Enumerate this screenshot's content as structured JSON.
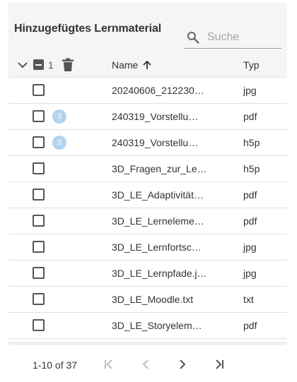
{
  "header": {
    "title": "Hinzugefügtes Lernmaterial",
    "search_placeholder": "Suche"
  },
  "table": {
    "selected_count": "1",
    "columns": {
      "name": "Name",
      "type": "Typ"
    },
    "sort": {
      "column": "Name",
      "direction": "ascending"
    },
    "rows": [
      {
        "name": "20240606_212230…",
        "type": "jpg",
        "badge": ""
      },
      {
        "name": "240319_Vorstellu…",
        "type": "pdf",
        "badge": "3"
      },
      {
        "name": "240319_Vorstellu…",
        "type": "h5p",
        "badge": "3"
      },
      {
        "name": "3D_Fragen_zur_Le…",
        "type": "h5p",
        "badge": ""
      },
      {
        "name": "3D_LE_Adaptivität…",
        "type": "pdf",
        "badge": ""
      },
      {
        "name": "3D_LE_Lerneleme…",
        "type": "pdf",
        "badge": ""
      },
      {
        "name": "3D_LE_Lernfortsc…",
        "type": "jpg",
        "badge": ""
      },
      {
        "name": "3D_LE_Lernpfade.j…",
        "type": "jpg",
        "badge": ""
      },
      {
        "name": "3D_LE_Moodle.txt",
        "type": "txt",
        "badge": ""
      },
      {
        "name": "3D_LE_Storyelem…",
        "type": "pdf",
        "badge": ""
      }
    ]
  },
  "pagination": {
    "range_label": "1-10 of 37"
  },
  "colors": {
    "header_bg": "#f5f5f5",
    "badge_bg": "#b3d4ef",
    "icon": "#555555",
    "disabled_icon": "#bdbdbd"
  }
}
